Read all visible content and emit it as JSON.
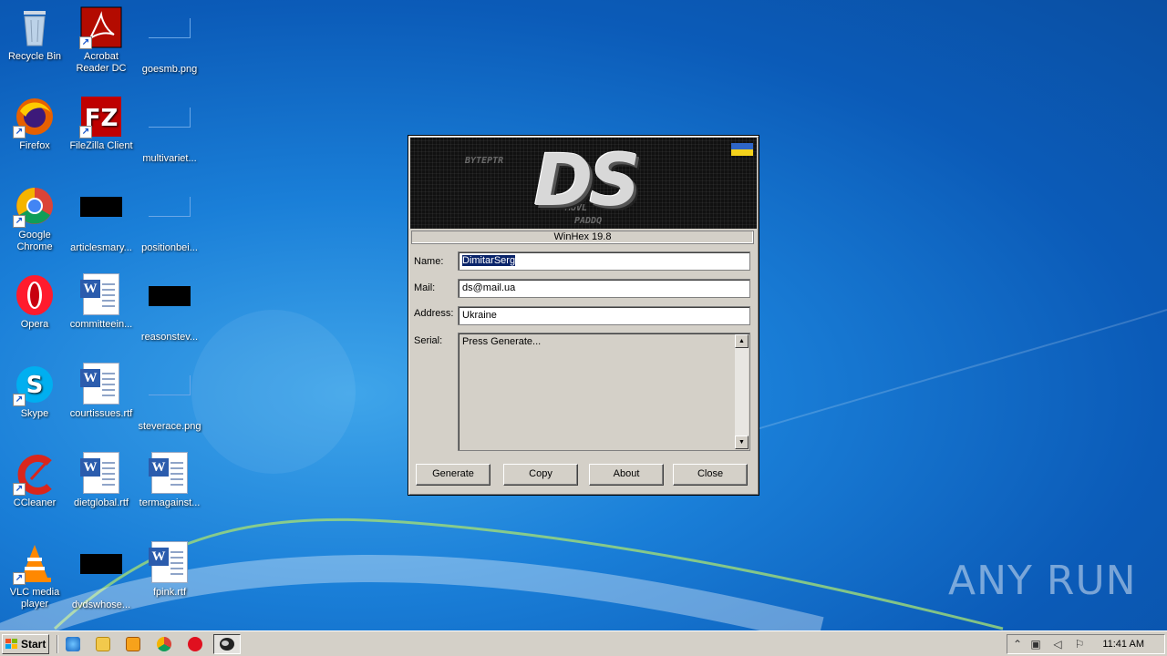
{
  "desktop": {
    "icons": [
      {
        "label": "Recycle Bin",
        "icon": "recycle-bin-icon"
      },
      {
        "label": "Acrobat Reader DC",
        "icon": "acrobat-icon"
      },
      {
        "label": "goesmb.png",
        "icon": "image-file-icon"
      },
      {
        "label": "Firefox",
        "icon": "firefox-icon"
      },
      {
        "label": "FileZilla Client",
        "icon": "filezilla-icon"
      },
      {
        "label": "multivariet...",
        "icon": "image-file-icon"
      },
      {
        "label": "Google Chrome",
        "icon": "chrome-icon"
      },
      {
        "label": "articlesmary...",
        "icon": "image-file-icon"
      },
      {
        "label": "positionbei...",
        "icon": "image-file-icon"
      },
      {
        "label": "Opera",
        "icon": "opera-icon"
      },
      {
        "label": "committeein...",
        "icon": "word-doc-icon"
      },
      {
        "label": "reasonstev...",
        "icon": "image-file-icon"
      },
      {
        "label": "Skype",
        "icon": "skype-icon"
      },
      {
        "label": "courtissues.rtf",
        "icon": "word-doc-icon"
      },
      {
        "label": "steverace.png",
        "icon": "image-file-icon"
      },
      {
        "label": "CCleaner",
        "icon": "ccleaner-icon"
      },
      {
        "label": "dietglobal.rtf",
        "icon": "word-doc-icon"
      },
      {
        "label": "termagainst...",
        "icon": "word-doc-icon"
      },
      {
        "label": "VLC media player",
        "icon": "vlc-icon"
      },
      {
        "label": "dvdswhose...",
        "icon": "image-file-icon"
      },
      {
        "label": "fpink.rtf",
        "icon": "word-doc-icon"
      }
    ]
  },
  "dialog": {
    "banner_logo": "DS",
    "banner_text_1": "MOVL",
    "banner_text_2": "PADDQ",
    "banner_text_3": "BYTEPTR",
    "version": "WinHex 19.8",
    "name_label": "Name:",
    "name_value": "DimitarSerg",
    "mail_label": "Mail:",
    "mail_value": "ds@mail.ua",
    "address_label": "Address:",
    "address_value": "Ukraine",
    "serial_label": "Serial:",
    "serial_value": "Press Generate...",
    "buttons": {
      "generate": "Generate",
      "copy": "Copy",
      "about": "About",
      "close": "Close"
    }
  },
  "taskbar": {
    "start_label": "Start",
    "clock": "11:41 AM"
  },
  "watermark": "ANY RUN"
}
